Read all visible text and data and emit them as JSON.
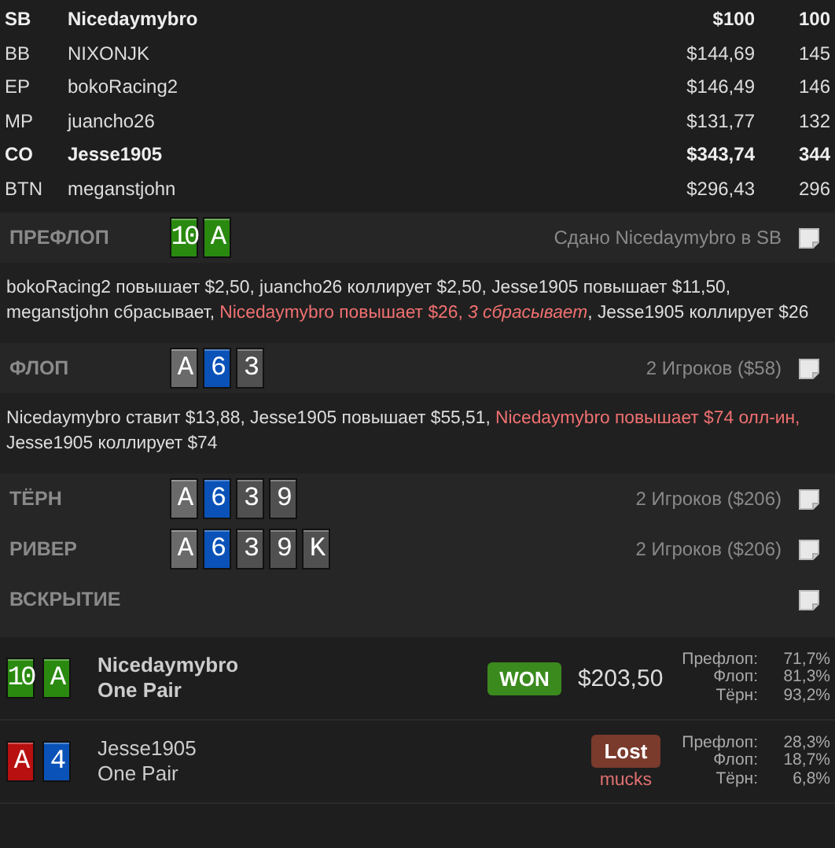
{
  "players": [
    {
      "position": "SB",
      "name": "Nicedaymybro",
      "stack": "$100",
      "bb": "100",
      "bold": true
    },
    {
      "position": "BB",
      "name": "NIXONJK",
      "stack": "$144,69",
      "bb": "145",
      "bold": false
    },
    {
      "position": "EP",
      "name": "bokoRacing2",
      "stack": "$146,49",
      "bb": "146",
      "bold": false
    },
    {
      "position": "MP",
      "name": "juancho26",
      "stack": "$131,77",
      "bb": "132",
      "bold": false
    },
    {
      "position": "CO",
      "name": "Jesse1905",
      "stack": "$343,74",
      "bb": "344",
      "bold": true
    },
    {
      "position": "BTN",
      "name": "meganstjohn",
      "stack": "$296,43",
      "bb": "296",
      "bold": false
    }
  ],
  "streets": [
    {
      "title": "ПРЕФЛОП",
      "cards": [
        {
          "rank": "10",
          "color": "#2a8a10"
        },
        {
          "rank": "A",
          "color": "#2a8a10"
        }
      ],
      "info": "Сдано Nicedaymybro в SB",
      "actions": [
        {
          "text": "bokoRacing2 повышает $2,50, juancho26 коллирует $2,50, Jesse1905 повышает $11,50, meganstjohn сбрасывает, ",
          "hero": false
        },
        {
          "text": "Nicedaymybro повышает $26, *3 сбрасывает*",
          "hero": true
        },
        {
          "text": ", Jesse1905 коллирует $26",
          "hero": false
        }
      ]
    },
    {
      "title": "ФЛОП",
      "cards": [
        {
          "rank": "A",
          "color": "#6a6a6a"
        },
        {
          "rank": "6",
          "color": "#0a52b8"
        },
        {
          "rank": "3",
          "color": "#505050"
        }
      ],
      "info": "2 Игроков ($58)",
      "actions": [
        {
          "text": "Nicedaymybro ставит $13,88, Jesse1905 повышает $55,51, ",
          "hero": false
        },
        {
          "text": "Nicedaymybro повышает $74 олл-ин,",
          "hero": true
        },
        {
          "text": " Jesse1905 коллирует $74",
          "hero": false
        }
      ]
    },
    {
      "title": "ТЁРН",
      "cards": [
        {
          "rank": "A",
          "color": "#6a6a6a"
        },
        {
          "rank": "6",
          "color": "#0a52b8"
        },
        {
          "rank": "3",
          "color": "#505050"
        },
        {
          "rank": "9",
          "color": "#505050"
        }
      ],
      "info": "2 Игроков ($206)"
    },
    {
      "title": "РИВЕР",
      "cards": [
        {
          "rank": "A",
          "color": "#6a6a6a"
        },
        {
          "rank": "6",
          "color": "#0a52b8"
        },
        {
          "rank": "3",
          "color": "#505050"
        },
        {
          "rank": "9",
          "color": "#505050"
        },
        {
          "rank": "K",
          "color": "#505050"
        }
      ],
      "info": "2 Игроков ($206)"
    },
    {
      "title": "ВСКРЫТИЕ"
    }
  ],
  "results": [
    {
      "cards": [
        {
          "rank": "10",
          "color": "#2a8a10"
        },
        {
          "rank": "A",
          "color": "#2a8a10"
        }
      ],
      "name": "Nicedaymybro",
      "hand": "One Pair",
      "bold": true,
      "kind": "won",
      "badge": "WON",
      "amount": "$203,50",
      "equity": [
        {
          "label": "Префлоп:",
          "value": "71,7%"
        },
        {
          "label": "Флоп:",
          "value": "81,3%"
        },
        {
          "label": "Тёрн:",
          "value": "93,2%"
        }
      ]
    },
    {
      "cards": [
        {
          "rank": "A",
          "color": "#b81010"
        },
        {
          "rank": "4",
          "color": "#0a52b8"
        }
      ],
      "name": "Jesse1905",
      "hand": "One Pair",
      "bold": false,
      "kind": "lost",
      "badge": "Lost",
      "note": "mucks",
      "equity": [
        {
          "label": "Префлоп:",
          "value": "28,3%"
        },
        {
          "label": "Флоп:",
          "value": "18,7%"
        },
        {
          "label": "Тёрн:",
          "value": "6,8%"
        }
      ]
    }
  ]
}
